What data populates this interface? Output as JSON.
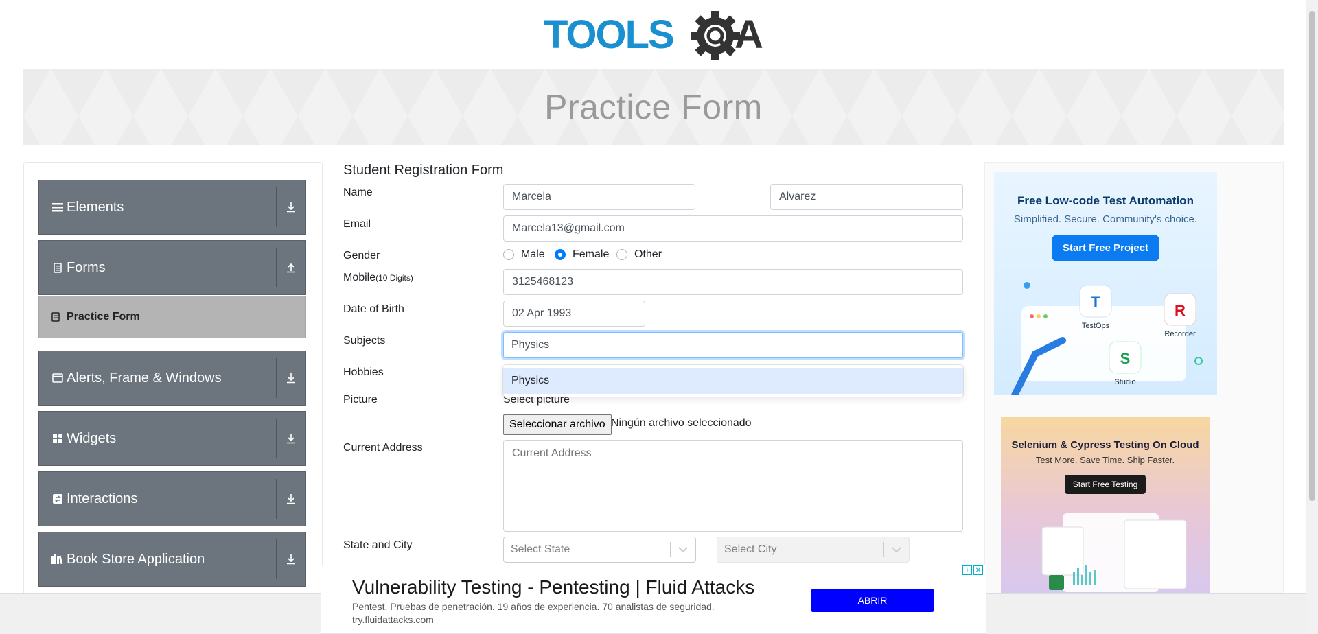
{
  "brand": {
    "logo_text_left": "TOOLS",
    "logo_text_right": "A"
  },
  "banner": {
    "title": "Practice Form"
  },
  "sidebar": {
    "groups": [
      {
        "label": "Elements",
        "icon": "menu-icon",
        "expanded": false
      },
      {
        "label": "Forms",
        "icon": "file-icon",
        "expanded": true
      },
      {
        "label": "Alerts, Frame & Windows",
        "icon": "window-icon",
        "expanded": false
      },
      {
        "label": "Widgets",
        "icon": "widgets-icon",
        "expanded": false
      },
      {
        "label": "Interactions",
        "icon": "interaction-icon",
        "expanded": false
      },
      {
        "label": "Book Store Application",
        "icon": "book-icon",
        "expanded": false
      }
    ],
    "active_item": {
      "label": "Practice Form",
      "icon": "form-icon"
    }
  },
  "form": {
    "title": "Student Registration Form",
    "labels": {
      "name": "Name",
      "email": "Email",
      "gender": "Gender",
      "mobile": "Mobile",
      "mobile_hint": "(10 Digits)",
      "dob": "Date of Birth",
      "subjects": "Subjects",
      "hobbies": "Hobbies",
      "picture": "Picture",
      "address": "Current Address",
      "state_city": "State and City"
    },
    "first_name": "Marcela",
    "last_name": "Alvarez",
    "email": "Marcela13@gmail.com",
    "gender_options": [
      "Male",
      "Female",
      "Other"
    ],
    "gender_selected": "Female",
    "mobile": "3125468123",
    "dob": "02 Apr 1993",
    "subjects_typed": "Physics",
    "subjects_suggestion": "Physics",
    "picture_label": "Select picture",
    "file_button": "Seleccionar archivo",
    "file_status": "Ningún archivo seleccionado",
    "address_placeholder": "Current Address",
    "state_placeholder": "Select State",
    "city_placeholder": "Select City"
  },
  "ads": {
    "ad1": {
      "title": "Free Low-code Test Automation",
      "subtitle": "Simplified. Secure. Community's choice.",
      "button": "Start Free Project",
      "labels": [
        "TestOps",
        "Recorder",
        "Studio"
      ]
    },
    "ad2": {
      "title": "Selenium & Cypress Testing On Cloud",
      "subtitle": "Test More. Save Time. Ship Faster.",
      "button": "Start Free Testing"
    },
    "bottom": {
      "headline": "Vulnerability Testing - Pentesting | Fluid Attacks",
      "description": "Pentest. Pruebas de penetración. 19 años de experiencia. 70 analistas de seguridad.",
      "url": "try.fluidattacks.com",
      "cta": "ABRIR"
    }
  },
  "colors": {
    "accent": "#007bff",
    "sidebar_group": "#6c757d",
    "active_item": "#b4b4b4",
    "logo_blue": "#1a90d0",
    "logo_dark": "#333333",
    "ad_cta": "#0000ff"
  }
}
